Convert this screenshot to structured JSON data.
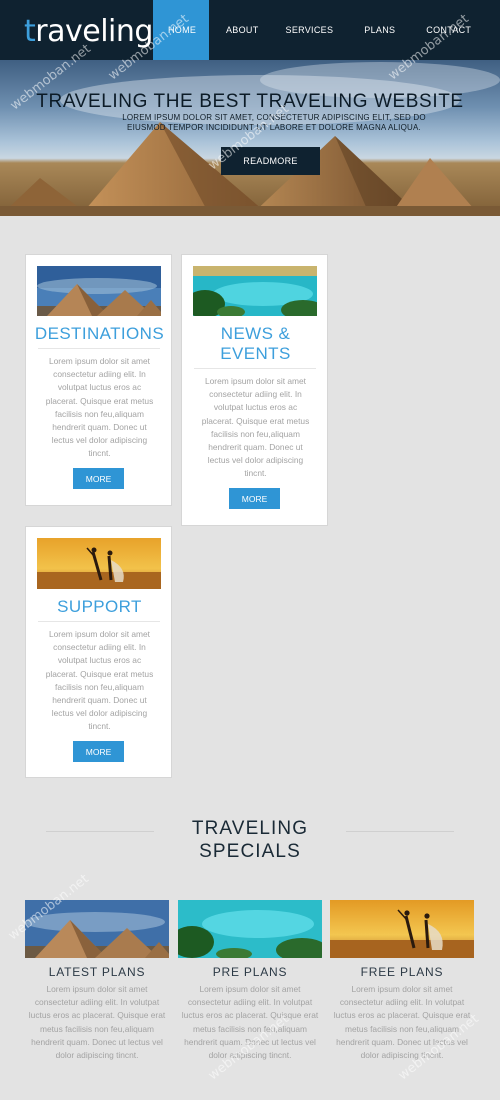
{
  "header": {
    "logo_first": "t",
    "logo_rest": "raveling",
    "nav": [
      "HOME",
      "ABOUT",
      "SERVICES",
      "PLANS",
      "CONTACT"
    ]
  },
  "banner": {
    "title": "TRAVELING THE BEST TRAVELING WEBSITE",
    "text": "LOREM IPSUM DOLOR SIT AMET, CONSECTETUR ADIPISCING ELIT, SED DO EIUSMOD TEMPOR INCIDIDUNT UT LABORE ET DOLORE MAGNA ALIQUA.",
    "button": "READMORE"
  },
  "features": [
    {
      "title": "DESTINATIONS",
      "text": "Lorem ipsum dolor sit amet consectetur adiing elit. In volutpat luctus eros ac placerat. Quisque erat metus facilisis non feu,aliquam hendrerit quam. Donec ut lectus vel dolor adipiscing tincnt.",
      "button": "MORE",
      "image": "pyramids"
    },
    {
      "title": "NEWS & EVENTS",
      "text": "Lorem ipsum dolor sit amet consectetur adiing elit. In volutpat luctus eros ac placerat. Quisque erat metus facilisis non feu,aliquam hendrerit quam. Donec ut lectus vel dolor adipiscing tincnt.",
      "button": "MORE",
      "image": "lagoon"
    },
    {
      "title": "SUPPORT",
      "text": "Lorem ipsum dolor sit amet consectetur adiing elit. In volutpat luctus eros ac placerat. Quisque erat metus facilisis non feu,aliquam hendrerit quam. Donec ut lectus vel dolor adipiscing tincnt.",
      "button": "MORE",
      "image": "sunset-couple"
    }
  ],
  "specials": {
    "title_line1": "TRAVELING",
    "title_line2": "SPECIALS",
    "items": [
      {
        "title": "LATEST PLANS",
        "text": "Lorem ipsum dolor sit amet consectetur adiing elit. In volutpat luctus eros ac placerat. Quisque erat metus facilisis non feu,aliquam hendrerit quam. Donec ut lectus vel dolor adipiscing tincnt.",
        "image": "pyramids"
      },
      {
        "title": "PRE PLANS",
        "text": "Lorem ipsum dolor sit amet consectetur adiing elit. In volutpat luctus eros ac placerat. Quisque erat metus facilisis non feu,aliquam hendrerit quam. Donec ut lectus vel dolor adipiscing tincnt.",
        "image": "lagoon"
      },
      {
        "title": "FREE PLANS",
        "text": "Lorem ipsum dolor sit amet consectetur adiing elit. In volutpat luctus eros ac placerat. Quisque erat metus facilisis non feu,aliquam hendrerit quam. Donec ut lectus vel dolor adipiscing tincnt.",
        "image": "sunset-couple"
      }
    ]
  },
  "watermark": "webmoban.net",
  "colors": {
    "accent": "#2f95d5",
    "header_bg": "#0f2230",
    "page_bg": "#e3e3e3"
  }
}
